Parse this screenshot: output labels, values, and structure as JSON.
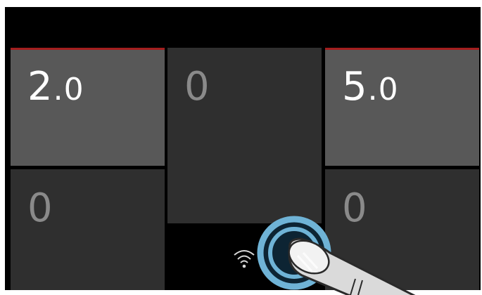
{
  "cooktop": {
    "zones": [
      {
        "id": "front-left",
        "integer": "2",
        "decimal": ".0",
        "state": "active"
      },
      {
        "id": "center",
        "integer": "0",
        "decimal": "",
        "state": "idle"
      },
      {
        "id": "front-right",
        "integer": "5",
        "decimal": ".0",
        "state": "active"
      },
      {
        "id": "rear-left",
        "integer": "0",
        "decimal": "",
        "state": "idle"
      },
      {
        "id": "rear-right",
        "integer": "0",
        "decimal": "",
        "state": "idle"
      }
    ],
    "colors": {
      "screen": "#000000",
      "active_zone": "#585858",
      "idle_zone": "#2f2f2f",
      "active_indicator": "#a31e1e",
      "touch_ring": "#6fb3d6"
    },
    "icons": [
      "link-icon",
      "wifi-icon",
      "touch-gesture-icon"
    ]
  }
}
